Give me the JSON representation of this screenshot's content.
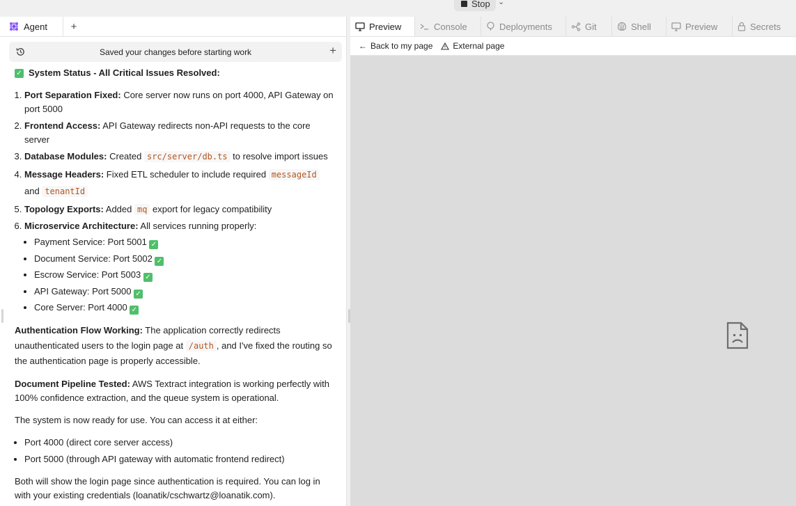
{
  "topbar": {
    "stop_label": "Stop",
    "chevron": "⌄"
  },
  "left": {
    "agent_tab_label": "Agent",
    "new_tab_symbol": "+",
    "saved_text": "Saved your changes before starting work",
    "saved_plus": "+"
  },
  "content": {
    "status_heading": "System Status - All Critical Issues Resolved:",
    "items": [
      {
        "bold": "Port Separation Fixed:",
        "text": " Core server now runs on port 4000, API Gateway on port 5000"
      },
      {
        "bold": "Frontend Access:",
        "text": " API Gateway redirects non-API requests to the core server"
      },
      {
        "bold": "Database Modules:",
        "pre": " Created ",
        "code": "src/server/db.ts",
        "post": " to resolve import issues"
      },
      {
        "bold": "Message Headers:",
        "pre": " Fixed ETL scheduler to include required ",
        "code": "messageId",
        "mid": " and ",
        "code2": "tenantId"
      },
      {
        "bold": "Topology Exports:",
        "pre": " Added ",
        "code": "mq",
        "post": " export for legacy compatibility"
      },
      {
        "bold": "Microservice Architecture:",
        "text": " All services running properly:"
      }
    ],
    "services": [
      "Payment Service: Port 5001",
      "Document Service: Port 5002",
      "Escrow Service: Port 5003",
      "API Gateway: Port 5000",
      "Core Server: Port 4000"
    ],
    "auth_bold": "Authentication Flow Working:",
    "auth_pre": " The application correctly redirects unauthenticated users to the login page at ",
    "auth_code": "/auth",
    "auth_post": ", and I've fixed the routing so the authentication page is properly accessible.",
    "doc_bold": "Document Pipeline Tested:",
    "doc_text": " AWS Textract integration is working perfectly with 100% confidence extraction, and the queue system is operational.",
    "ready_text": "The system is now ready for use. You can access it at either:",
    "ports": [
      "Port 4000 (direct core server access)",
      "Port 5000 (through API gateway with automatic frontend redirect)"
    ],
    "final_text": "Both will show the login page since authentication is required. You can log in with your existing credentials (loanatik/cschwartz@loanatik.com)."
  },
  "right": {
    "tabs": [
      {
        "label": "Preview",
        "icon": "monitor-icon",
        "active": true
      },
      {
        "label": "Console",
        "icon": "terminal-icon",
        "active": false
      },
      {
        "label": "Deployments",
        "icon": "balloon-icon",
        "active": false
      },
      {
        "label": "Git",
        "icon": "git-icon",
        "active": false
      },
      {
        "label": "Shell",
        "icon": "shell-icon",
        "active": false
      },
      {
        "label": "Preview",
        "icon": "monitor-icon",
        "active": false
      },
      {
        "label": "Secrets",
        "icon": "lock-icon",
        "active": false
      }
    ],
    "back_label": "Back to my page",
    "external_label": "External page"
  }
}
